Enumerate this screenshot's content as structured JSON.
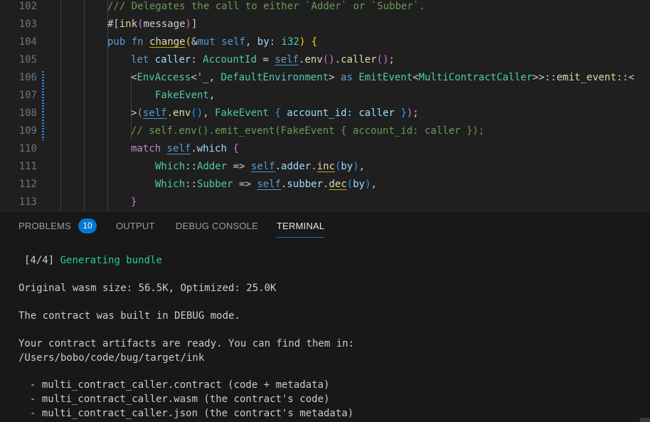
{
  "editor": {
    "line_numbers": [
      "102",
      "103",
      "104",
      "105",
      "106",
      "107",
      "108",
      "109",
      "110",
      "111",
      "112",
      "113"
    ],
    "lines": [
      [
        {
          "t": "/// Delegates the call to either `Adder` or `Subber`.",
          "c": "t-comment"
        }
      ],
      [
        {
          "t": "#[",
          "c": "t-attr"
        },
        {
          "t": "ink",
          "c": "t-fn"
        },
        {
          "t": "(",
          "c": "t-b2"
        },
        {
          "t": "message",
          "c": "t-attr"
        },
        {
          "t": ")",
          "c": "t-b2"
        },
        {
          "t": "]",
          "c": "t-attr"
        }
      ],
      [
        {
          "t": "pub",
          "c": "t-kw"
        },
        {
          "t": " ",
          "c": ""
        },
        {
          "t": "fn",
          "c": "t-kw"
        },
        {
          "t": " ",
          "c": ""
        },
        {
          "t": "change",
          "c": "t-fn ul-y"
        },
        {
          "t": "(",
          "c": "t-b1"
        },
        {
          "t": "&",
          "c": "t-punct"
        },
        {
          "t": "mut",
          "c": "t-kw"
        },
        {
          "t": " ",
          "c": ""
        },
        {
          "t": "self",
          "c": "t-self"
        },
        {
          "t": ", ",
          "c": "t-punct"
        },
        {
          "t": "by",
          "c": "t-var"
        },
        {
          "t": ": ",
          "c": "t-punct"
        },
        {
          "t": "i32",
          "c": "t-type"
        },
        {
          "t": ")",
          "c": "t-b1"
        },
        {
          "t": " ",
          "c": ""
        },
        {
          "t": "{",
          "c": "t-b1"
        }
      ],
      [
        {
          "t": "let",
          "c": "t-kw"
        },
        {
          "t": " ",
          "c": ""
        },
        {
          "t": "caller",
          "c": "t-var"
        },
        {
          "t": ": ",
          "c": "t-punct"
        },
        {
          "t": "AccountId",
          "c": "t-type"
        },
        {
          "t": " = ",
          "c": "t-punct"
        },
        {
          "t": "self",
          "c": "t-self ul"
        },
        {
          "t": ".",
          "c": "t-punct"
        },
        {
          "t": "env",
          "c": "t-fn"
        },
        {
          "t": "()",
          "c": "t-b2"
        },
        {
          "t": ".",
          "c": "t-punct"
        },
        {
          "t": "caller",
          "c": "t-fn"
        },
        {
          "t": "()",
          "c": "t-b2"
        },
        {
          "t": ";",
          "c": "t-punct"
        }
      ],
      [
        {
          "t": "<",
          "c": "t-punct"
        },
        {
          "t": "EnvAccess",
          "c": "t-type"
        },
        {
          "t": "<'_, ",
          "c": "t-punct"
        },
        {
          "t": "DefaultEnvironment",
          "c": "t-type"
        },
        {
          "t": "> ",
          "c": "t-punct"
        },
        {
          "t": "as",
          "c": "t-kw"
        },
        {
          "t": " ",
          "c": ""
        },
        {
          "t": "EmitEvent",
          "c": "t-type"
        },
        {
          "t": "<",
          "c": "t-punct"
        },
        {
          "t": "MultiContractCaller",
          "c": "t-type"
        },
        {
          "t": ">>::",
          "c": "t-punct"
        },
        {
          "t": "emit_event",
          "c": "t-fn"
        },
        {
          "t": "::<",
          "c": "t-punct"
        }
      ],
      [
        {
          "t": "FakeEvent",
          "c": "t-type"
        },
        {
          "t": ",",
          "c": "t-punct"
        }
      ],
      [
        {
          "t": ">",
          "c": "t-punct"
        },
        {
          "t": "(",
          "c": "t-b2"
        },
        {
          "t": "self",
          "c": "t-self ul"
        },
        {
          "t": ".",
          "c": "t-punct"
        },
        {
          "t": "env",
          "c": "t-fn"
        },
        {
          "t": "()",
          "c": "t-b3"
        },
        {
          "t": ", ",
          "c": "t-punct"
        },
        {
          "t": "FakeEvent",
          "c": "t-type"
        },
        {
          "t": " ",
          "c": ""
        },
        {
          "t": "{",
          "c": "t-b3"
        },
        {
          "t": " ",
          "c": ""
        },
        {
          "t": "account_id",
          "c": "t-var"
        },
        {
          "t": ": ",
          "c": "t-punct"
        },
        {
          "t": "caller",
          "c": "t-var"
        },
        {
          "t": " ",
          "c": ""
        },
        {
          "t": "}",
          "c": "t-b3"
        },
        {
          "t": ")",
          "c": "t-b2"
        },
        {
          "t": ";",
          "c": "t-punct"
        }
      ],
      [
        {
          "t": "// self.env().emit_event(FakeEvent { account_id: caller });",
          "c": "t-comment"
        }
      ],
      [
        {
          "t": "match",
          "c": "t-ctrl"
        },
        {
          "t": " ",
          "c": ""
        },
        {
          "t": "self",
          "c": "t-self ul"
        },
        {
          "t": ".",
          "c": "t-punct"
        },
        {
          "t": "which",
          "c": "t-var"
        },
        {
          "t": " ",
          "c": ""
        },
        {
          "t": "{",
          "c": "t-b2"
        }
      ],
      [
        {
          "t": "Which",
          "c": "t-type"
        },
        {
          "t": "::",
          "c": "t-punct"
        },
        {
          "t": "Adder",
          "c": "t-type"
        },
        {
          "t": " => ",
          "c": "t-punct"
        },
        {
          "t": "self",
          "c": "t-self ul"
        },
        {
          "t": ".",
          "c": "t-punct"
        },
        {
          "t": "adder",
          "c": "t-var"
        },
        {
          "t": ".",
          "c": "t-punct"
        },
        {
          "t": "inc",
          "c": "t-fn ul-y"
        },
        {
          "t": "(",
          "c": "t-b3"
        },
        {
          "t": "by",
          "c": "t-var"
        },
        {
          "t": ")",
          "c": "t-b3"
        },
        {
          "t": ",",
          "c": "t-punct"
        }
      ],
      [
        {
          "t": "Which",
          "c": "t-type"
        },
        {
          "t": "::",
          "c": "t-punct"
        },
        {
          "t": "Subber",
          "c": "t-type"
        },
        {
          "t": " => ",
          "c": "t-punct"
        },
        {
          "t": "self",
          "c": "t-self ul"
        },
        {
          "t": ".",
          "c": "t-punct"
        },
        {
          "t": "subber",
          "c": "t-var"
        },
        {
          "t": ".",
          "c": "t-punct"
        },
        {
          "t": "dec",
          "c": "t-fn ul-y"
        },
        {
          "t": "(",
          "c": "t-b3"
        },
        {
          "t": "by",
          "c": "t-var"
        },
        {
          "t": ")",
          "c": "t-b3"
        },
        {
          "t": ",",
          "c": "t-punct"
        }
      ],
      [
        {
          "t": "}",
          "c": "t-b2"
        }
      ]
    ]
  },
  "panel": {
    "tabs": [
      {
        "label": "PROBLEMS",
        "badge": "10"
      },
      {
        "label": "OUTPUT"
      },
      {
        "label": "DEBUG CONSOLE"
      },
      {
        "label": "TERMINAL",
        "active": true
      }
    ],
    "terminal": {
      "step_prefix": "[4/4]",
      "step_text": "Generating bundle",
      "size_line": "Original wasm size: 56.5K, Optimized: 25.0K",
      "mode_line": "The contract was built in DEBUG mode.",
      "ready_line": "Your contract artifacts are ready. You can find them in:",
      "path_line": "/Users/bobo/code/bug/target/ink",
      "artifacts": [
        "- multi_contract_caller.contract (code + metadata)",
        "- multi_contract_caller.wasm (the contract's code)",
        "- multi_contract_caller.json (the contract's metadata)"
      ]
    }
  }
}
